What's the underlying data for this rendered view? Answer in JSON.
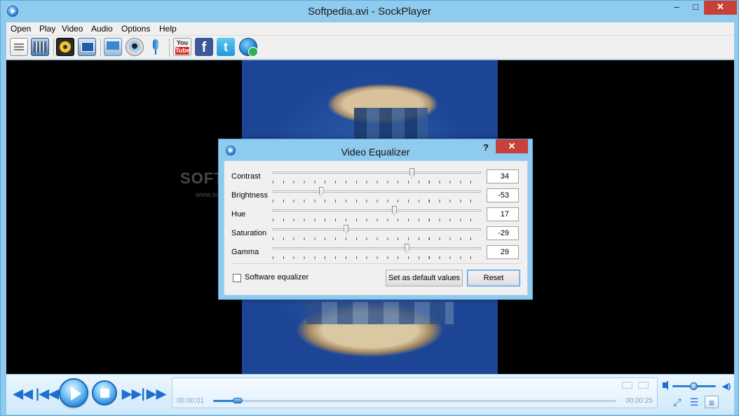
{
  "window": {
    "title": "Softpedia.avi - SockPlayer",
    "minimize_glyph": "–",
    "maximize_glyph": "□",
    "close_glyph": "✕"
  },
  "menu": [
    "Open",
    "Play",
    "Video",
    "Audio",
    "Options",
    "Help"
  ],
  "toolbar": {
    "icons": [
      "open-file-icon",
      "open-dvd-icon",
      "open-disc-icon",
      "capture-screen-icon",
      "desktop-stream-icon",
      "webcam-icon",
      "microphone-icon",
      "youtube-icon",
      "facebook-icon",
      "twitter-icon",
      "web-update-icon"
    ],
    "youtube_top": "You",
    "youtube_bottom": "Tube",
    "facebook_glyph": "f",
    "twitter_glyph": "t"
  },
  "watermark": {
    "text": "SOFTPEDIA",
    "url": "www.softpedia.com"
  },
  "equalizer": {
    "title": "Video Equalizer",
    "help": "?",
    "close_glyph": "✕",
    "range": [
      -100,
      100
    ],
    "rows": [
      {
        "label": "Contrast",
        "value": "34",
        "level": 34
      },
      {
        "label": "Brightness",
        "value": "-53",
        "level": -53
      },
      {
        "label": "Hue",
        "value": "17",
        "level": 17
      },
      {
        "label": "Saturation",
        "value": "-29",
        "level": -29
      },
      {
        "label": "Gamma",
        "value": "29",
        "level": 29
      }
    ],
    "software_eq_label": "Software equalizer",
    "software_eq_checked": false,
    "default_button": "Set as default values",
    "reset_button": "Reset"
  },
  "player": {
    "time_current": "00:00:01",
    "time_total": "00:00:25",
    "progress": 0.06,
    "volume": 0.5,
    "rewind_glyph": "◀◀",
    "prev_glyph": "|◀◀",
    "next_glyph": "▶▶|",
    "forward_glyph": "▶▶",
    "fullscreen_glyph": "⤢",
    "playlist_glyph": "☰",
    "settings_glyph": "≡",
    "volume_max_glyph": "◀)"
  },
  "colors": {
    "accent": "#1d6fd0",
    "close_red": "#c7413a",
    "frame": "#8fcbef"
  }
}
